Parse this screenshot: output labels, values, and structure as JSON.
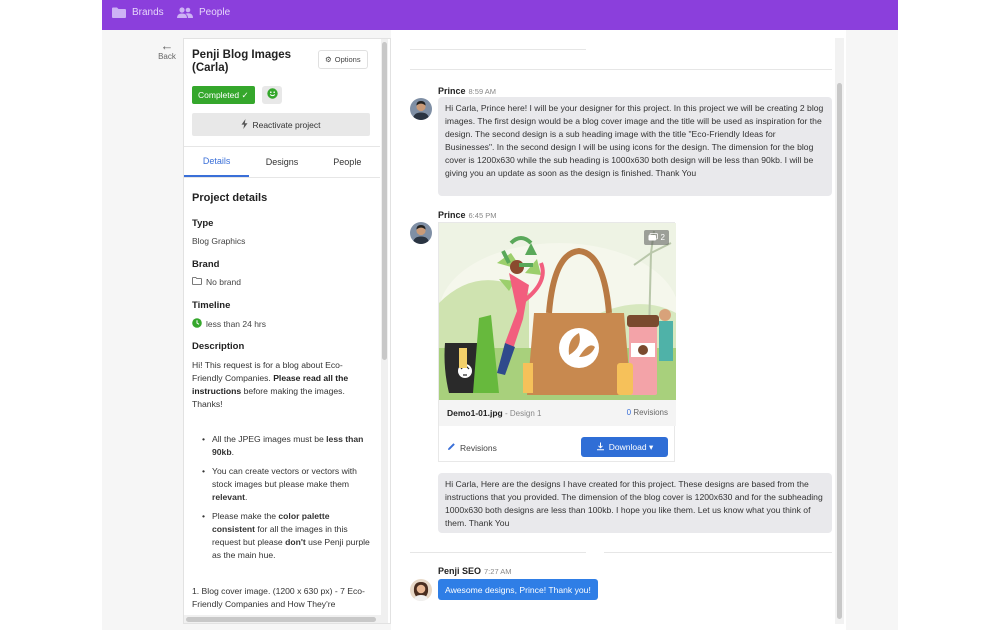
{
  "topbar": {
    "accent": "#8b3fdc",
    "items": [
      {
        "label": "Brands",
        "icon": "folder-icon"
      },
      {
        "label": "People",
        "icon": "people-icon"
      }
    ]
  },
  "back": {
    "label": "Back",
    "icon": "arrow-left-icon"
  },
  "project": {
    "title": "Penji Blog Images (Carla)",
    "options_label": "Options",
    "status": "Completed ✓",
    "status_color": "#35a72c",
    "reactivate_label": "Reactivate project",
    "tabs": [
      "Details",
      "Designs",
      "People"
    ],
    "active_tab": "Details",
    "details_heading": "Project details",
    "type_label": "Type",
    "type_value": "Blog Graphics",
    "brand_label": "Brand",
    "brand_value": "No brand",
    "timeline_label": "Timeline",
    "timeline_value": "less than 24 hrs",
    "description_label": "Description",
    "description": {
      "p1_a": "Hi! This request is for a blog about  Eco-Friendly Companies. ",
      "p1_b": "Please read all the instructions",
      "p1_c": " before making the images. Thanks!",
      "bullet1_a": "All the JPEG images must be ",
      "bullet1_b": "less than 90kb",
      "bullet1_c": ".",
      "bullet2_a": "You can create vectors or vectors with stock images but please make them ",
      "bullet2_b": "relevant",
      "bullet2_c": ".",
      "bullet3_a": "Please make the ",
      "bullet3_b": "color palette consistent",
      "bullet3_c": " for all the images in this request but please ",
      "bullet3_d": "don't",
      "bullet3_e": " use Penji purple as the main hue.",
      "numbered1": "1. Blog cover image. (1200 x 630 px) - 7 Eco-Friendly Companies and How They're"
    }
  },
  "messages": [
    {
      "sender": "Prince",
      "time": "8:59 AM",
      "text": "Hi Carla, Prince here! I will be your designer for this project. In this project we will be creating 2 blog images. The first design would be a blog cover image and the title will be used as inspiration for the design. The second design is a sub heading image with the title \"Eco-Friendly Ideas for Businesses\". In the second design I will be using icons for the design. The dimension for the blog cover is 1200x630 while the sub heading is 1000x630 both design will be less than 90kb. I will be giving you an update as soon as the design is finished. Thank You"
    },
    {
      "sender": "Prince",
      "time": "6:45 PM",
      "attachment": {
        "image_count": "2",
        "file_name": "Demo1-01.jpg",
        "design_label": " - Design 1",
        "revisions_count": "0",
        "revisions_suffix": " Revisions",
        "revisions_link": "Revisions",
        "download_label": "Download ▾"
      },
      "text": "Hi Carla, Here are the designs I have created for this project. These designs are based from the instructions that you provided. The dimension of the blog cover is 1200x630 and for the subheading 1000x630 both designs are less than 100kb. I hope you like them. Let us know what you think of them. Thank You"
    },
    {
      "sender": "Penji SEO",
      "time": "7:27 AM",
      "text": "Awesome designs, Prince! Thank you!"
    }
  ]
}
